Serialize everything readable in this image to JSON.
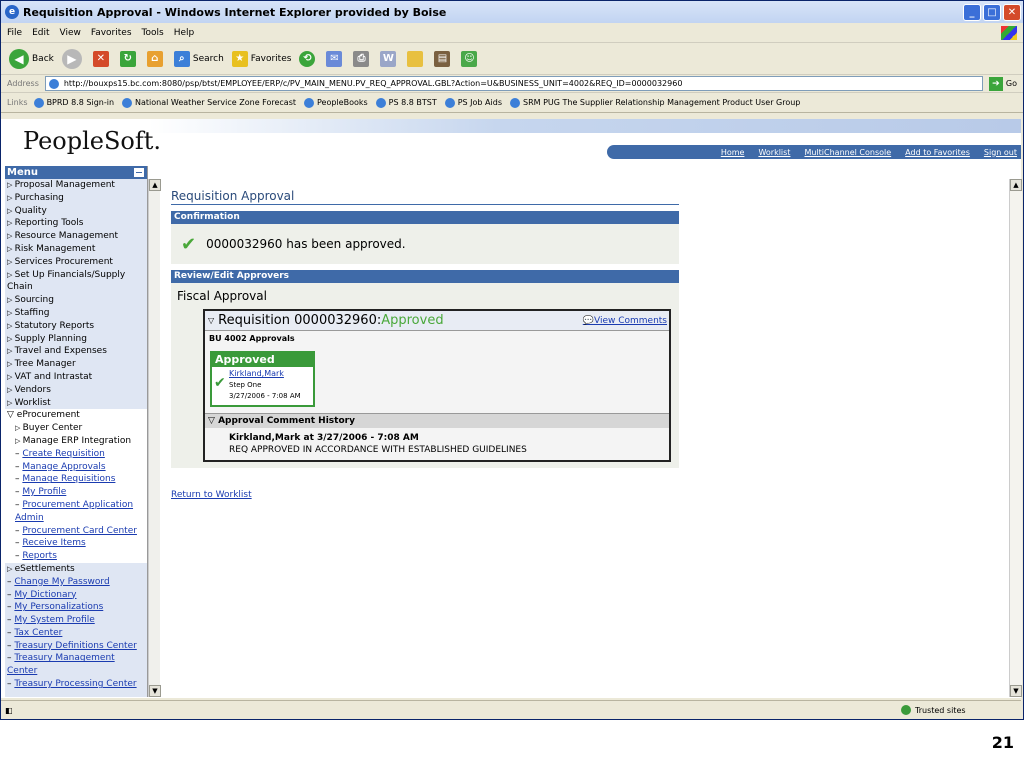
{
  "window": {
    "title": "Requisition Approval - Windows Internet Explorer provided by Boise"
  },
  "menubar": [
    "File",
    "Edit",
    "View",
    "Favorites",
    "Tools",
    "Help"
  ],
  "toolbar": {
    "back": "Back",
    "search": "Search",
    "favorites": "Favorites"
  },
  "address": {
    "label": "Address",
    "url": "http://bouxps15.bc.com:8080/psp/btst/EMPLOYEE/ERP/c/PV_MAIN_MENU.PV_REQ_APPROVAL.GBL?Action=U&BUSINESS_UNIT=4002&REQ_ID=0000032960",
    "go": "Go"
  },
  "links": {
    "label": "Links",
    "items": [
      "BPRD 8.8 Sign-in",
      "National Weather Service Zone Forecast",
      "PeopleBooks",
      "PS 8.8 BTST",
      "PS Job Aids",
      "SRM PUG The Supplier Relationship Management Product User Group"
    ]
  },
  "header": {
    "logo": "PeopleSoft.",
    "nav": [
      "Home",
      "Worklist",
      "MultiChannel Console",
      "Add to Favorites",
      "Sign out"
    ]
  },
  "sidebar": {
    "title": "Menu",
    "items": [
      "Proposal Management",
      "Purchasing",
      "Quality",
      "Reporting Tools",
      "Resource Management",
      "Risk Management",
      "Services Procurement",
      "Set Up Financials/Supply Chain",
      "Sourcing",
      "Staffing",
      "Statutory Reports",
      "Supply Planning",
      "Travel and Expenses",
      "Tree Manager",
      "VAT and Intrastat",
      "Vendors",
      "Worklist"
    ],
    "eproc": "eProcurement",
    "eproc_sub": [
      "Buyer Center",
      "Manage ERP Integration"
    ],
    "eproc_links": [
      "Create Requisition",
      "Manage Approvals",
      "Manage Requisitions",
      "My Profile",
      "Procurement Application Admin",
      "Procurement Card Center",
      "Receive Items",
      "Reports"
    ],
    "esettlements": "eSettlements",
    "bottom_links": [
      "Change My Password",
      "My Dictionary",
      "My Personalizations",
      "My System Profile",
      "Tax Center",
      "Treasury Definitions Center",
      "Treasury Management Center",
      "Treasury Processing Center"
    ]
  },
  "main": {
    "page_title": "Requisition Approval",
    "confirmation_header": "Confirmation",
    "confirmation_text": "0000032960 has been approved.",
    "review_header": "Review/Edit Approvers",
    "fiscal": "Fiscal Approval",
    "req_label": "Requisition 0000032960:",
    "req_status": "Approved",
    "view_comments": "View Comments",
    "bu": "BU 4002 Approvals",
    "approved_box": {
      "title": "Approved",
      "name": "Kirkland,Mark",
      "step": "Step One",
      "date": "3/27/2006 - 7:08 AM"
    },
    "history_header": "Approval Comment History",
    "history_line1": "Kirkland,Mark at 3/27/2006 - 7:08 AM",
    "history_line2": "REQ APPROVED IN ACCORDANCE WITH ESTABLISHED GUIDELINES",
    "return": "Return to Worklist"
  },
  "status": {
    "zone": "Trusted sites"
  },
  "slide_number": "21",
  "colors": {
    "ps_blue": "#3f6aa8",
    "approved_green": "#4aa83a"
  }
}
